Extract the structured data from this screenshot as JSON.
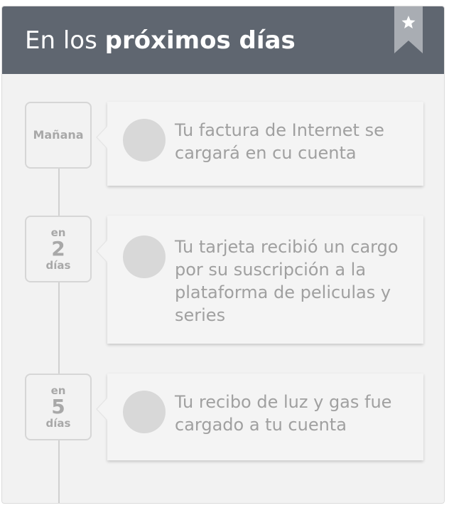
{
  "header": {
    "title_normal": "En los ",
    "title_bold": "próximos días",
    "ribbon_icon": "star-icon",
    "background_color": "#5f6670"
  },
  "timeline": [
    {
      "badge": {
        "single": "Mañana"
      },
      "text": "Tu factura de Internet se cargará en cu cuenta"
    },
    {
      "badge": {
        "top": "en",
        "number": "2",
        "bottom": "días"
      },
      "text": "Tu tarjeta recibió un cargo por su suscripción a la plataforma de peliculas y series"
    },
    {
      "badge": {
        "top": "en",
        "number": "5",
        "bottom": "días"
      },
      "text": "Tu recibo de luz y gas fue cargado a tu cuenta"
    }
  ]
}
